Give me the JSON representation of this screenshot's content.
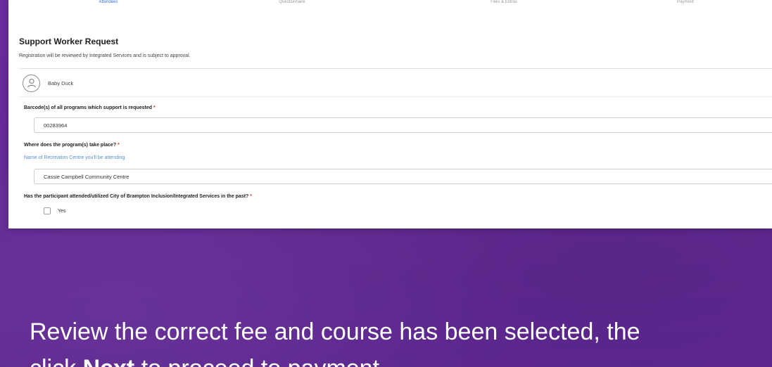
{
  "steps": [
    "Attendees",
    "Questionnaire",
    "Fees & Extras",
    "Payment"
  ],
  "form": {
    "title": "Support Worker Request",
    "subtitle": "Registration will be reviewed by Integrated Services and is subject to approval.",
    "participant_name": "Baby Duck",
    "q1_label": "Barcode(s) of all programs which support is requested",
    "q1_value": "00283964",
    "q2_label": "Where does the program(s) take place?",
    "q2_help": "Name of Recreation Centre you'll be attending",
    "q2_value": "Cassie Campbell Community Centre",
    "q3_label": "Has the participant attended/utilized City of Brampton Inclusion/Integrated Services in the past?",
    "q3_option": "Yes",
    "required_mark": "*"
  },
  "caption": {
    "line1": "Review the correct fee and course has been selected, the",
    "line2_pre": "click ",
    "line2_bold": "Next",
    "line2_post": " to proceed to payment."
  },
  "colors": {
    "background": "#652a97",
    "active_step": "#3a6fd8",
    "required": "#d93025",
    "help_text": "#5a8ed0"
  },
  "icons": {
    "avatar": "person-icon"
  }
}
